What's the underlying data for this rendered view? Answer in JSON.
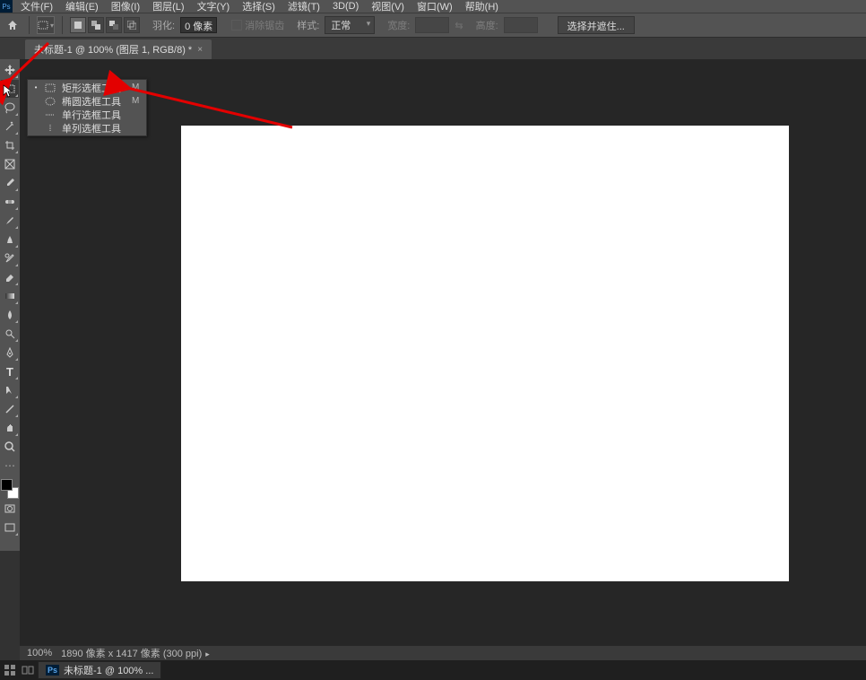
{
  "app_icon_label": "Ps",
  "menu": {
    "file": "文件(F)",
    "edit": "编辑(E)",
    "image": "图像(I)",
    "layer": "图层(L)",
    "type": "文字(Y)",
    "select": "选择(S)",
    "filter": "滤镜(T)",
    "threeD": "3D(D)",
    "view": "视图(V)",
    "window": "窗口(W)",
    "help": "帮助(H)"
  },
  "options": {
    "feather_label": "羽化:",
    "feather_value": "0 像素",
    "antialias_label": "消除锯齿",
    "style_label": "样式:",
    "style_value": "正常",
    "width_label": "宽度:",
    "height_label": "高度:",
    "select_mask_btn": "选择并遮住..."
  },
  "doc_tab": {
    "title": "未标题-1 @ 100% (图层 1, RGB/8) *",
    "close": "×"
  },
  "flyout": {
    "items": [
      {
        "label": "矩形选框工具",
        "key": "M",
        "active": true,
        "icon": "rect"
      },
      {
        "label": "椭圆选框工具",
        "key": "M",
        "active": false,
        "icon": "ellipse"
      },
      {
        "label": "单行选框工具",
        "key": "",
        "active": false,
        "icon": "row"
      },
      {
        "label": "单列选框工具",
        "key": "",
        "active": false,
        "icon": "col"
      }
    ]
  },
  "status": {
    "zoom": "100%",
    "doc_info": "1890 像素 x 1417 像素 (300 ppi)"
  },
  "taskbar": {
    "ps_label": "Ps",
    "doc_title": "未标题-1 @ 100% ..."
  },
  "icons": {
    "home": "⌂",
    "move": "✥",
    "marquee": "▭",
    "lasso": "◯",
    "wand": "✦",
    "crop": "✂",
    "frame": "⊞",
    "eyedrop": "✎",
    "heal": "✚",
    "brush": "🖌",
    "stamp": "⛶",
    "history": "↺",
    "eraser": "◧",
    "gradient": "▦",
    "blur": "💧",
    "dodge": "◐",
    "pen": "✒",
    "type": "T",
    "path": "↖",
    "shape": "／",
    "hand": "✋",
    "zoom": "🔍",
    "more": "⋯",
    "expand": "▭",
    "quickmask": "◫",
    "ellipse": "◯",
    "row": "⋯",
    "col": "⋮",
    "swap": "⇆"
  }
}
